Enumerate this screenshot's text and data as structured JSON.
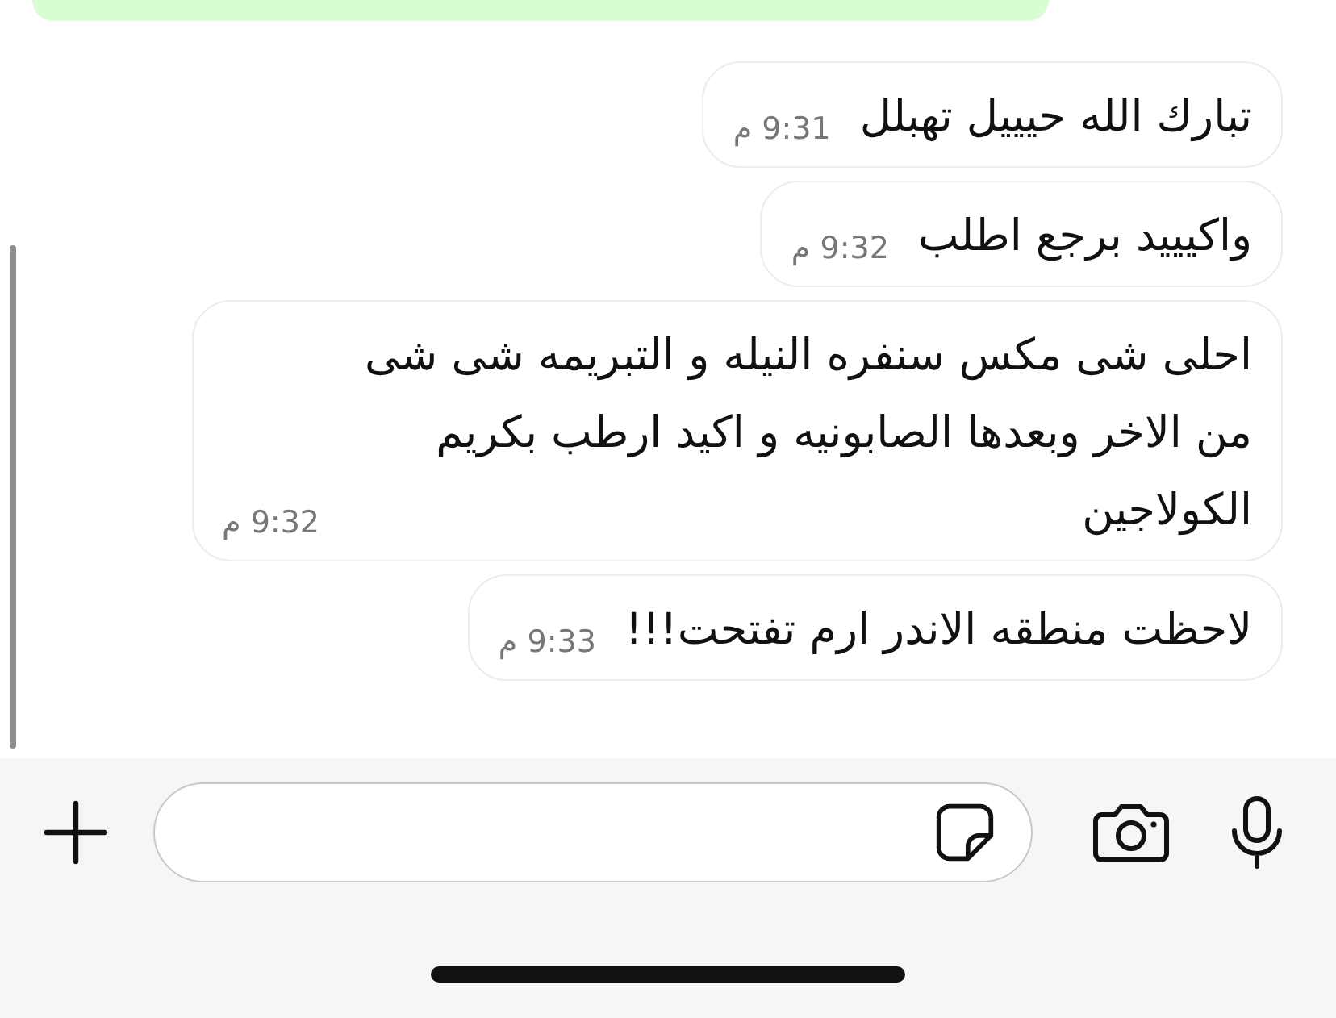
{
  "partial_bubble": {
    "kind": "outgoing"
  },
  "messages": [
    {
      "kind": "incoming",
      "text": "تبارك الله حيييل تهبلل",
      "time": "9:31 م"
    },
    {
      "kind": "incoming",
      "text": "واكيييد برجع اطلب",
      "time": "9:32 م"
    },
    {
      "kind": "incoming",
      "text": "احلى شى مكس سنفره النيله و التبريمه شى شى من الاخر وبعدها الصابونيه و اكيد ارطب بكريم الكولاجين",
      "time": "9:32 م"
    },
    {
      "kind": "incoming",
      "text": "لاحظت منطقه الاندر ارم تفتحت!!!",
      "time": "9:33 م"
    }
  ]
}
